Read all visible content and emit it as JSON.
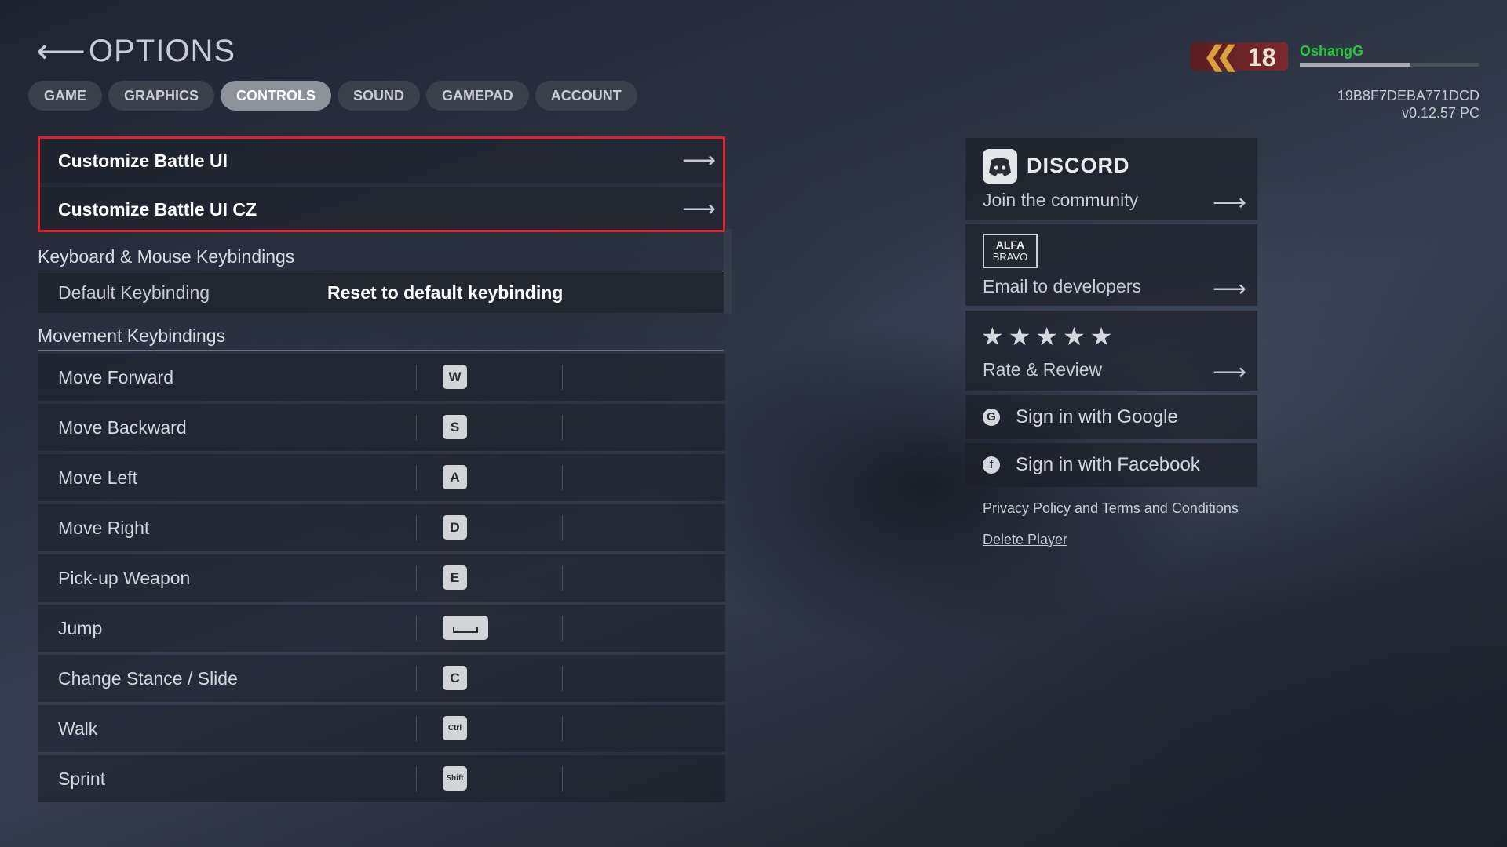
{
  "header": {
    "title": "OPTIONS",
    "back_icon": "back-arrow-icon"
  },
  "tabs": [
    {
      "label": "GAME",
      "active": false
    },
    {
      "label": "GRAPHICS",
      "active": false
    },
    {
      "label": "CONTROLS",
      "active": true
    },
    {
      "label": "SOUND",
      "active": false
    },
    {
      "label": "GAMEPAD",
      "active": false
    },
    {
      "label": "ACCOUNT",
      "active": false
    }
  ],
  "player": {
    "rank": "18",
    "name": "OshangG",
    "xp_progress": 0.62,
    "id": "19B8F7DEBA771DCD",
    "version": "v0.12.57 PC"
  },
  "menu": [
    {
      "label": "Customize Battle UI"
    },
    {
      "label": "Customize Battle UI CZ"
    }
  ],
  "sections": {
    "keyboard": "Keyboard & Mouse Keybindings",
    "movement": "Movement Keybindings"
  },
  "default_keybinding": {
    "label": "Default Keybinding",
    "button": "Reset to default keybinding"
  },
  "keybindings": [
    {
      "action": "Move Forward",
      "key": "W"
    },
    {
      "action": "Move Backward",
      "key": "S"
    },
    {
      "action": "Move Left",
      "key": "A"
    },
    {
      "action": "Move Right",
      "key": "D"
    },
    {
      "action": "Pick-up Weapon",
      "key": "E"
    },
    {
      "action": "Jump",
      "key": ""
    },
    {
      "action": "Change Stance / Slide",
      "key": "C"
    },
    {
      "action": "Walk",
      "key": "Ctrl"
    },
    {
      "action": "Sprint",
      "key": "Shift"
    }
  ],
  "community": {
    "discord_word": "DISCORD",
    "discord_sub": "Join the community",
    "alfa_top": "ALFA",
    "alfa_bottom": "BRAVO",
    "email_sub": "Email to developers",
    "stars": "★★★★★",
    "rate_sub": "Rate & Review",
    "google": "Sign in with Google",
    "facebook": "Sign in with Facebook"
  },
  "legal": {
    "privacy": "Privacy Policy",
    "and": "and",
    "terms": "Terms and Conditions",
    "delete": "Delete Player"
  },
  "colors": {
    "highlight": "#e0202a",
    "player_name": "#26c93c",
    "rank_badge": "#7a2a2e",
    "active_tab": "#8e939b"
  }
}
